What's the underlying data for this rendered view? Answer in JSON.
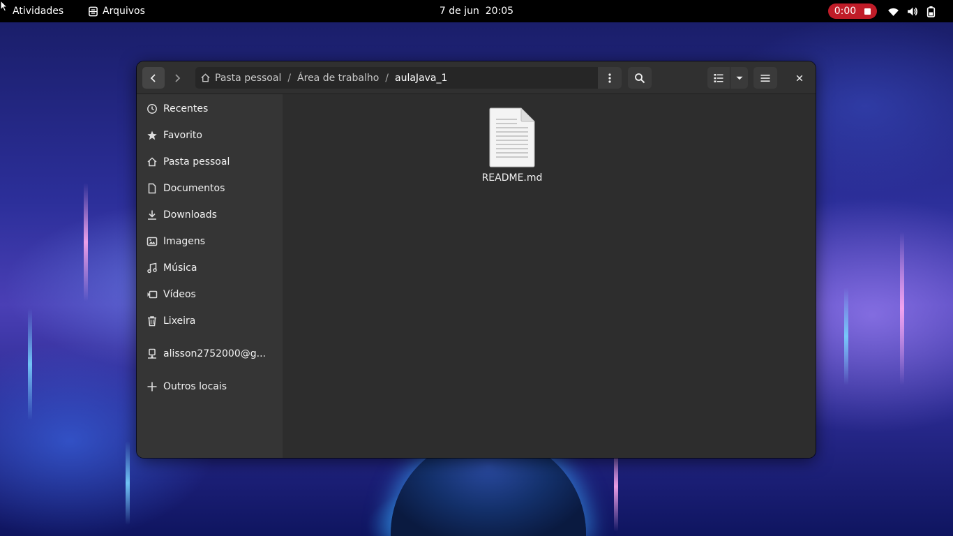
{
  "topbar": {
    "activities_label": "Atividades",
    "app_name": "Arquivos",
    "app_icon": "file-cabinet-icon",
    "clock": "7 de jun  20:05",
    "recording_time": "0:00",
    "status_icons": [
      "wifi-icon",
      "volume-icon",
      "battery-icon"
    ]
  },
  "window": {
    "nav": {
      "back_icon": "chevron-left-icon",
      "forward_icon": "chevron-right-icon"
    },
    "breadcrumb": {
      "home_icon": "home-icon",
      "items": [
        "Pasta pessoal",
        "Área de trabalho",
        "aulaJava_1"
      ],
      "separator": "/"
    },
    "sidebar": {
      "items": [
        {
          "label": "Recentes",
          "icon": "clock-icon"
        },
        {
          "label": "Favorito",
          "icon": "star-icon"
        },
        {
          "label": "Pasta pessoal",
          "icon": "home-icon"
        },
        {
          "label": "Documentos",
          "icon": "document-icon"
        },
        {
          "label": "Downloads",
          "icon": "download-icon"
        },
        {
          "label": "Imagens",
          "icon": "image-icon"
        },
        {
          "label": "Música",
          "icon": "music-icon"
        },
        {
          "label": "Vídeos",
          "icon": "video-icon"
        },
        {
          "label": "Lixeira",
          "icon": "trash-icon"
        },
        {
          "label": "alisson2752000@g...",
          "icon": "network-drive-icon"
        },
        {
          "label": "Outros locais",
          "icon": "plus-icon"
        }
      ]
    },
    "files": [
      {
        "name": "README.md",
        "icon": "text-file-icon"
      }
    ]
  },
  "colors": {
    "topbar_bg": "#000000",
    "record_badge": "#c01c28",
    "window_bg": "#2d2d2d",
    "sidebar_bg": "#353535",
    "headerbar_bg": "#303030"
  }
}
